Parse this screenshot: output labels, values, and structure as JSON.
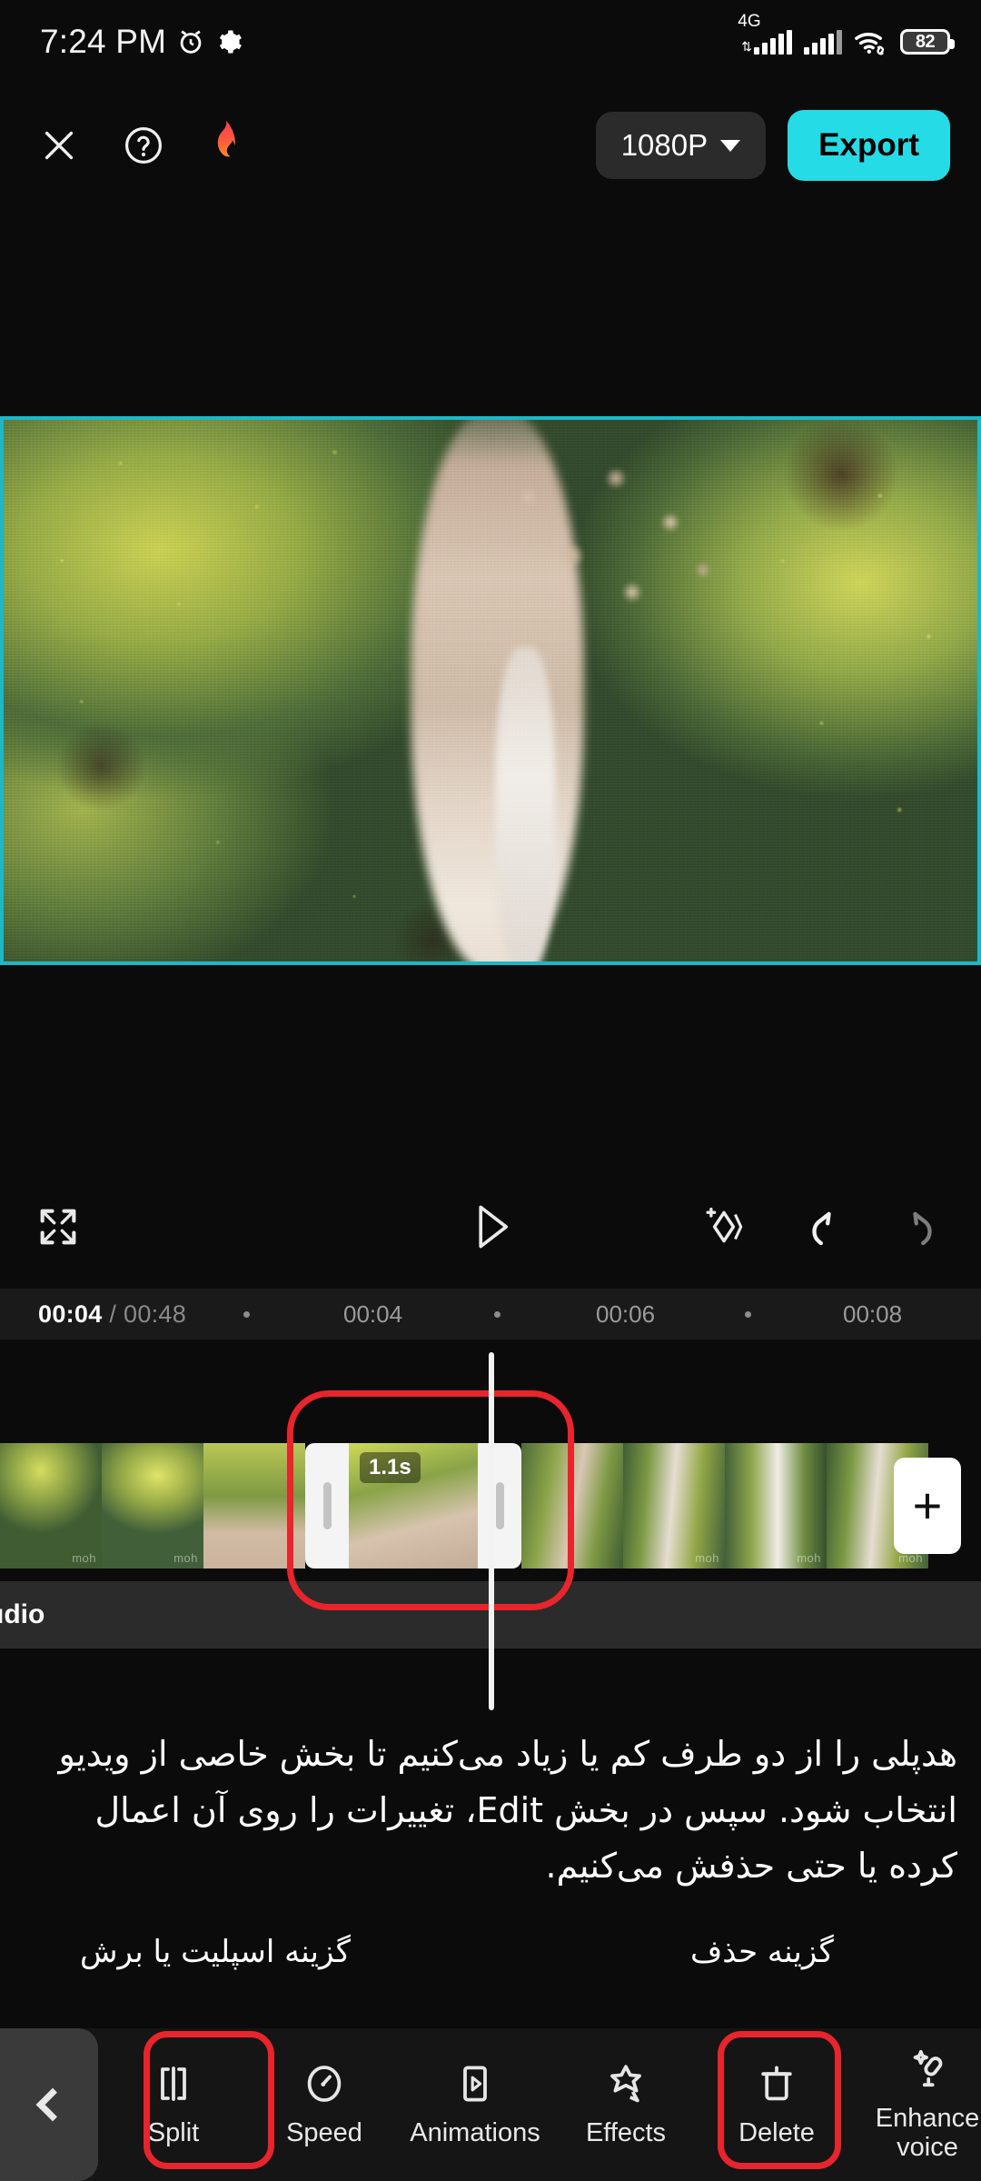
{
  "status_bar": {
    "time": "7:24 PM",
    "alarm_icon": "alarm-icon",
    "settings_icon": "gear-icon",
    "network_label": "4G",
    "wifi_icon": "wifi-icon",
    "battery_level": "82"
  },
  "top_bar": {
    "close_icon": "close-icon",
    "help_icon": "help-circle-icon",
    "flame_icon": "flame-icon",
    "resolution": "1080P",
    "export_label": "Export",
    "export_color": "#25DCE6"
  },
  "preview": {
    "border_color": "#1cb8c8"
  },
  "playback": {
    "fullscreen_icon": "fullscreen-icon",
    "play_icon": "play-icon",
    "keyframe_icon": "add-keyframe-icon",
    "undo_icon": "undo-icon",
    "redo_icon": "redo-icon"
  },
  "timeline": {
    "current_time": "00:04",
    "separator": "/",
    "total_time": "00:48",
    "ticks": [
      "00:04",
      "00:06",
      "00:08"
    ],
    "selected_clip_duration": "1.1s",
    "add_clip_icon": "plus-icon",
    "audio_track_label": "udio"
  },
  "annotations": {
    "split_caption": "گزینه اسپلیت یا برش",
    "delete_caption": "گزینه حذف",
    "highlight_color": "#e8242c"
  },
  "description": {
    "text": "هدپلی را از دو طرف کم یا زیاد می‌کنیم تا بخش خاصی از ویدیو انتخاب شود. سپس در بخش Edit، تغییرات را روی آن اعمال کرده یا حتی حذفش می‌کنیم."
  },
  "bottom_toolbar": {
    "back_icon": "chevron-left-icon",
    "tools": [
      {
        "label": "Split",
        "icon": "split-icon"
      },
      {
        "label": "Speed",
        "icon": "speed-icon"
      },
      {
        "label": "Animations",
        "icon": "animations-icon"
      },
      {
        "label": "Effects",
        "icon": "effects-icon"
      },
      {
        "label": "Delete",
        "icon": "trash-icon"
      },
      {
        "label": "Enhance voice",
        "icon": "enhance-voice-icon"
      }
    ]
  }
}
